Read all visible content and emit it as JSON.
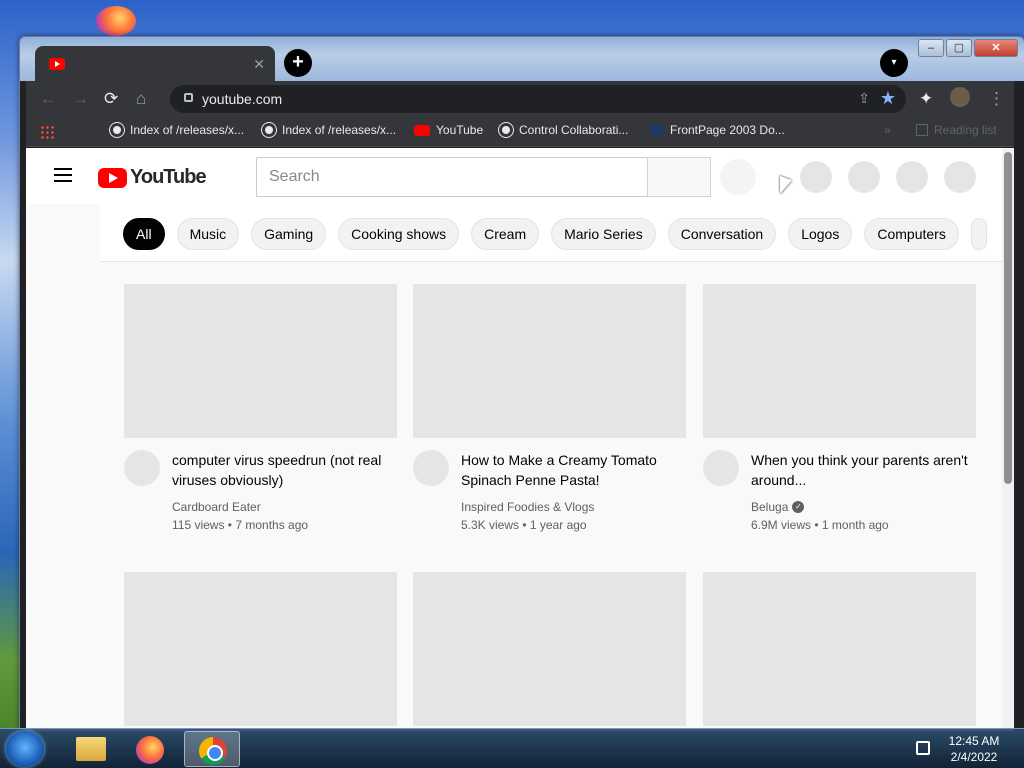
{
  "browser": {
    "tab": {
      "title": ""
    },
    "new_tab_symbol": "+",
    "tab_search_symbol": "▾",
    "window_buttons": {
      "minimize": "–",
      "maximize": "▢",
      "close": "✕"
    },
    "nav": {
      "back": "←",
      "forward": "→",
      "reload": "⟳",
      "home": "⌂"
    },
    "address": {
      "url": "youtube.com"
    },
    "bookmarks": [
      {
        "label": "Index of /releases/x...",
        "icon": "globe-icon"
      },
      {
        "label": "Index of /releases/x...",
        "icon": "globe-icon"
      },
      {
        "label": "YouTube",
        "icon": "youtube-icon"
      },
      {
        "label": "Control Collaborati...",
        "icon": "globe-icon"
      },
      {
        "label": "FrontPage 2003 Do...",
        "icon": "page-icon"
      }
    ],
    "bookmarks_overflow": "»",
    "reading_list": "Reading list"
  },
  "youtube": {
    "logo_text": "YouTube",
    "search_placeholder": "Search",
    "chips": [
      {
        "label": "All",
        "active": true
      },
      {
        "label": "Music"
      },
      {
        "label": "Gaming"
      },
      {
        "label": "Cooking shows"
      },
      {
        "label": "Cream"
      },
      {
        "label": "Mario Series"
      },
      {
        "label": "Conversation"
      },
      {
        "label": "Logos"
      },
      {
        "label": "Computers"
      }
    ],
    "videos": [
      {
        "title": "computer virus speedrun (not real viruses obviously)",
        "channel": "Cardboard Eater",
        "verified": false,
        "stats": "115 views • 7 months ago"
      },
      {
        "title": "How to Make a Creamy Tomato Spinach Penne Pasta!",
        "channel": "Inspired Foodies & Vlogs",
        "verified": false,
        "stats": "5.3K views • 1 year ago"
      },
      {
        "title": "When you think your parents aren't around...",
        "channel": "Beluga",
        "verified": true,
        "stats": "6.9M views • 1 month ago"
      }
    ]
  },
  "taskbar": {
    "time": "12:45 AM",
    "date": "2/4/2022"
  },
  "colors": {
    "youtube_red": "#ff0000",
    "chrome_dark": "#35363a",
    "star_blue": "#8ab4f8"
  }
}
